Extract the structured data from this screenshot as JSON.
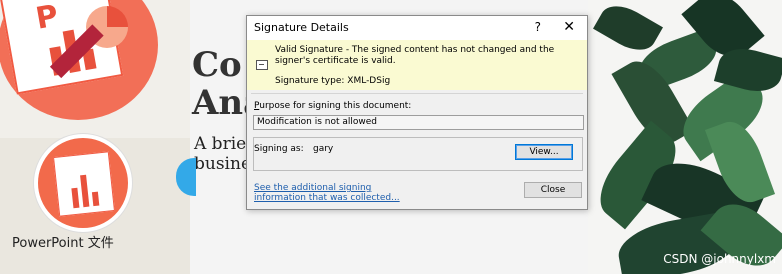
{
  "background": {
    "app_label": "PowerPoint 文件",
    "slide_title_lines": [
      "Co",
      "Ana"
    ],
    "slide_body_lines": [
      "A brief",
      "busines"
    ],
    "watermark": "CSDN @johnnylxm",
    "colors": {
      "ppt_orange": "#f26f57",
      "ppt_red": "#e8513c",
      "blue_accent": "#33a9e8"
    }
  },
  "dialog": {
    "title": "Signature Details",
    "help_label": "?",
    "close_label": "✕",
    "status_message": "Valid Signature - The signed content has not changed and the signer's certificate is valid.",
    "signature_type": "Signature type: XML-DSig",
    "purpose_label_u": "P",
    "purpose_label_rest": "urpose for signing this document:",
    "purpose_value": "Modification is not allowed",
    "signing_as_label": "Signing as:",
    "signer": "gary",
    "view_button": "View...",
    "info_link": "See the additional signing information that was collected...",
    "close_button": "Close"
  }
}
